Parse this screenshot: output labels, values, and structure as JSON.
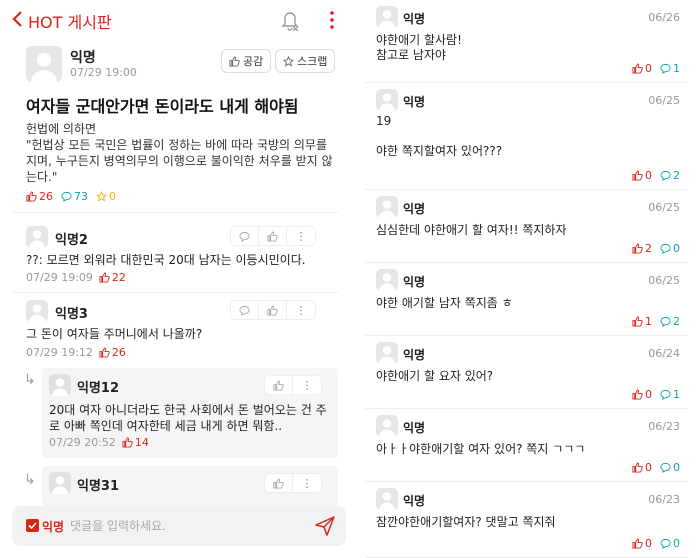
{
  "header": {
    "title": "HOT 게시판"
  },
  "post": {
    "author": "익명",
    "time": "07/29 19:00",
    "like_btn": "공감",
    "scrap_btn": "스크랩",
    "title": "여자들 군대안가면 돈이라도 내게 해야됨",
    "body_line1": "헌법에 의하면",
    "body_line2": "\"헌법상 모든 국민은 법률이 정하는 바에 따라 국방의 의무를 지며, 누구든지 병역의무의 이행으로 불이익한 처우를 받지 않는다.\"",
    "likes": "26",
    "comments": "73",
    "scraps": "0"
  },
  "comments": [
    {
      "name": "익명2",
      "text": "??: 모르면 외워라 대한민국 20대 남자는 이등시민이다.",
      "time": "07/29 19:09",
      "likes": "22"
    },
    {
      "name": "익명3",
      "text": "그 돈이 여자들 주머니에서 나올까?",
      "time": "07/29 19:12",
      "likes": "26"
    }
  ],
  "replies": [
    {
      "name": "익명12",
      "text": "20대 여자 아니더라도 한국 사회에서 돈 벌어오는 건 주로 아빠 쪽인데 여자한테 세금 내게 하면 뭐함..",
      "time": "07/29 20:52",
      "likes": "14"
    },
    {
      "name": "익명31"
    }
  ],
  "input": {
    "anon_label": "익명",
    "placeholder": "댓글을 입력하세요."
  },
  "list": [
    {
      "name": "익명",
      "date": "06/26",
      "text": "야한애기 할사람!\n참고로 남자야",
      "likes": "0",
      "comments": "1"
    },
    {
      "name": "익명",
      "date": "06/25",
      "text": "19\n\n야한 쪽지할여자 있어???",
      "likes": "0",
      "comments": "2"
    },
    {
      "name": "익명",
      "date": "06/25",
      "text": "심심한데 야한애기 할 여자!! 쪽지하자",
      "likes": "2",
      "comments": "0"
    },
    {
      "name": "익명",
      "date": "06/25",
      "text": "야한 애기할 남자 쪽지좀 ㅎ",
      "likes": "1",
      "comments": "2"
    },
    {
      "name": "익명",
      "date": "06/24",
      "text": "야한애기 할 요자 있어?",
      "likes": "0",
      "comments": "1"
    },
    {
      "name": "익명",
      "date": "06/23",
      "text": "아ㅏㅏ야한애기할 여자 있어? 쪽지 ㄱㄱㄱ",
      "likes": "0",
      "comments": "0"
    },
    {
      "name": "익명",
      "date": "06/23",
      "text": "잠깐야한애기할여자? 댓말고 쪽지줘",
      "likes": "0",
      "comments": "0"
    }
  ],
  "colors": {
    "accent": "#d8261c",
    "comment": "#0ca5b0",
    "scrap": "#f0b400"
  },
  "icons": [
    "back-chevron-icon",
    "bell-off-icon",
    "more-vertical-icon",
    "thumbs-up-icon",
    "star-icon",
    "speech-bubble-icon",
    "send-icon",
    "reply-arrow-icon"
  ]
}
